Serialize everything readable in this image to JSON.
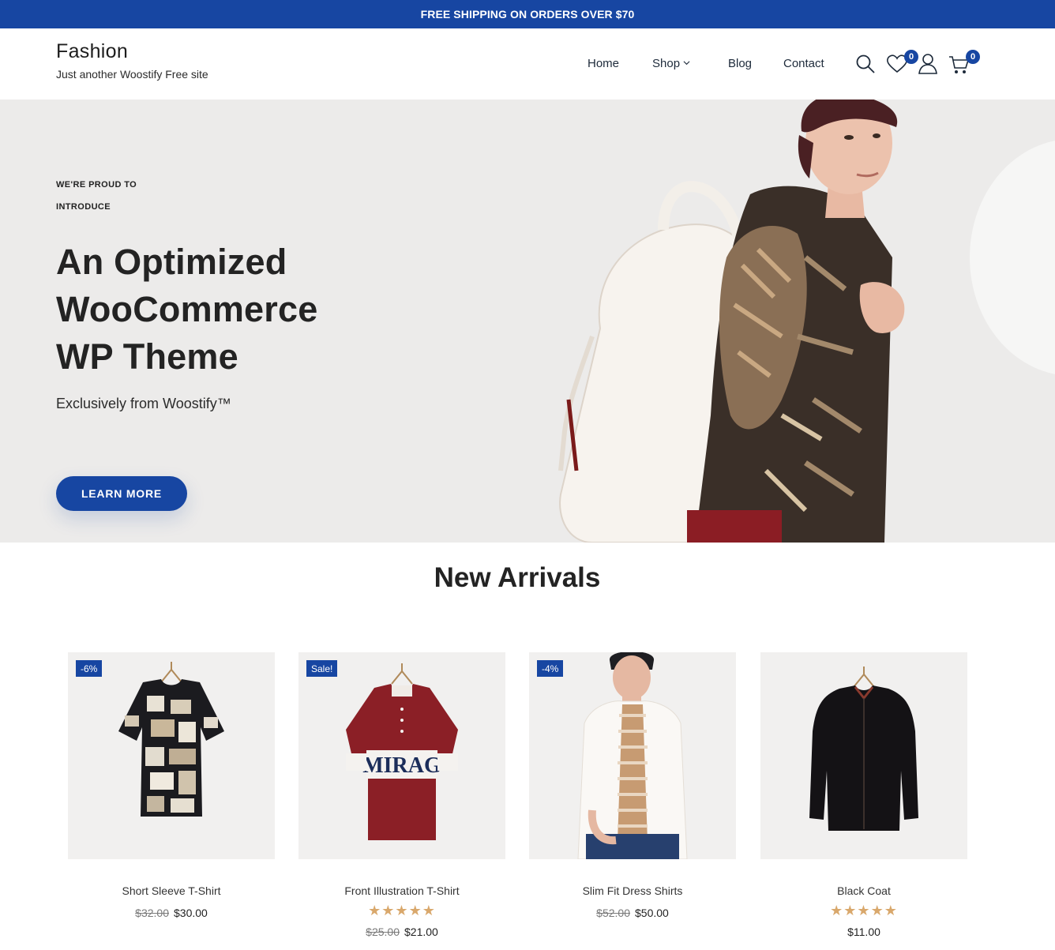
{
  "topbar": {
    "text": "FREE SHIPPING ON ORDERS OVER $70"
  },
  "brand": {
    "title": "Fashion",
    "tagline": "Just another Woostify Free site"
  },
  "nav": {
    "home": "Home",
    "shop": "Shop",
    "blog": "Blog",
    "contact": "Contact"
  },
  "header_icons": {
    "wishlist_count": "0",
    "cart_count": "0"
  },
  "hero": {
    "kicker": "WE'RE PROUD TO INTRODUCE",
    "heading_line1": "An Optimized",
    "heading_line2": "WooCommerce",
    "heading_line3": "WP Theme",
    "subheading": "Exclusively from Woostify™",
    "button": "LEARN MORE"
  },
  "section": {
    "title": "New Arrivals"
  },
  "products": [
    {
      "name": "Short Sleeve T-Shirt",
      "badge": "-6%",
      "old_price": "$32.00",
      "price": "$30.00",
      "rating": 0
    },
    {
      "name": "Front Illustration T-Shirt",
      "badge": "Sale!",
      "old_price": "$25.00",
      "price": "$21.00",
      "rating": 5,
      "stars": "★★★★★"
    },
    {
      "name": "Slim Fit Dress Shirts",
      "badge": "-4%",
      "old_price": "$52.00",
      "price": "$50.00",
      "rating": 0
    },
    {
      "name": "Black Coat",
      "badge": "",
      "old_price": "",
      "price": "$11.00",
      "rating": 5,
      "stars": "★★★★★"
    }
  ],
  "colors": {
    "accent": "#1746a2",
    "star": "#d9a86c",
    "hero_bg": "#ecebea",
    "product_bg": "#f1f0ef"
  }
}
